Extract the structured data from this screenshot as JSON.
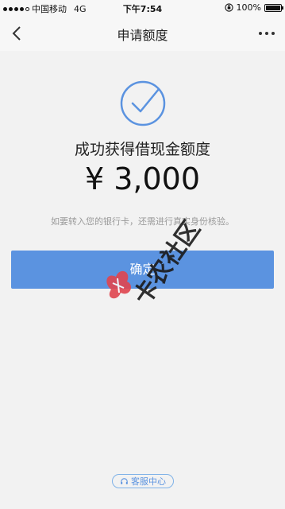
{
  "status_bar": {
    "carrier": "中国移动",
    "network": "4G",
    "time": "下午7:54",
    "battery_label": "100%",
    "battery_level": 1.0
  },
  "nav": {
    "title": "申请额度",
    "back_icon": "chevron-left-icon",
    "more_icon": "more-dots-icon"
  },
  "result": {
    "icon": "check-circle-icon",
    "title": "成功获得借现金额度",
    "amount": "¥ 3,000",
    "tip": "如要转入您的银行卡，还需进行真实身份核验。"
  },
  "confirm": {
    "label": "确定"
  },
  "watermark": {
    "text": "卡农社区"
  },
  "footer": {
    "service_label": "客服中心",
    "service_icon": "headset-icon"
  },
  "colors": {
    "accent": "#5b93e0",
    "watermark": "#e0454f",
    "background": "#f2f2f2"
  }
}
